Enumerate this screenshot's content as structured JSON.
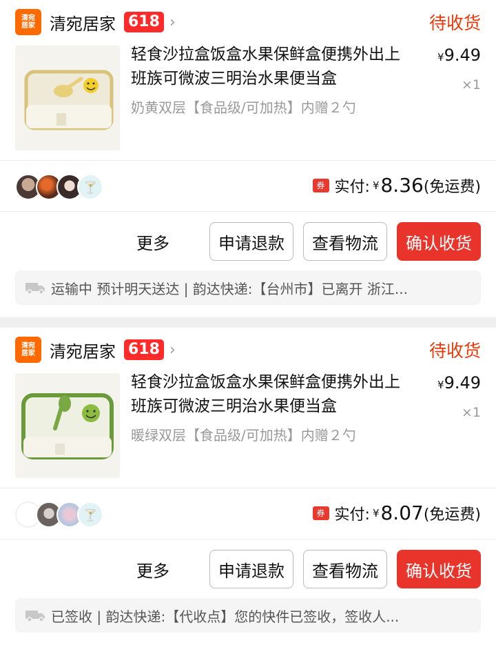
{
  "orders": [
    {
      "shop": {
        "logo_text": "清宛居家",
        "name": "清宛居家",
        "badge": "618",
        "chevron": "›"
      },
      "status": "待收货",
      "product": {
        "title": "轻食沙拉盒饭盒水果保鲜盒便携外出上班族可微波三明治水果便当盒",
        "spec": "奶黄双层【食品级/可加热】内赠２勺",
        "price_symbol": "¥",
        "price": "9.49",
        "qty": "×1",
        "theme_color": "#d9c37a"
      },
      "paid": {
        "coupon": "券",
        "label": "实付:",
        "symbol": "¥",
        "amount": "8.36",
        "note": "(免运费)"
      },
      "actions": {
        "more": "更多",
        "refund": "申请退款",
        "logistics": "查看物流",
        "confirm": "确认收货"
      },
      "logistics_text": "运输中 预计明天送达 | 韵达快递:【台州市】已离开 浙江..."
    },
    {
      "shop": {
        "logo_text": "清宛居家",
        "name": "清宛居家",
        "badge": "618",
        "chevron": "›"
      },
      "status": "待收货",
      "product": {
        "title": "轻食沙拉盒饭盒水果保鲜盒便携外出上班族可微波三明治水果便当盒",
        "spec": "暖绿双层【食品级/可加热】内赠２勺",
        "price_symbol": "¥",
        "price": "9.49",
        "qty": "×1",
        "theme_color": "#6b9a3a"
      },
      "paid": {
        "coupon": "券",
        "label": "实付:",
        "symbol": "¥",
        "amount": "8.07",
        "note": "(免运费)"
      },
      "actions": {
        "more": "更多",
        "refund": "申请退款",
        "logistics": "查看物流",
        "confirm": "确认收货"
      },
      "logistics_text": "已签收 | 韵达快递:【代收点】您的快件已签收，签收人..."
    }
  ],
  "colors": {
    "accent": "#e8342a",
    "status": "#e8390a",
    "badge": "#ff2a2a",
    "logo": "#ff6a00"
  }
}
